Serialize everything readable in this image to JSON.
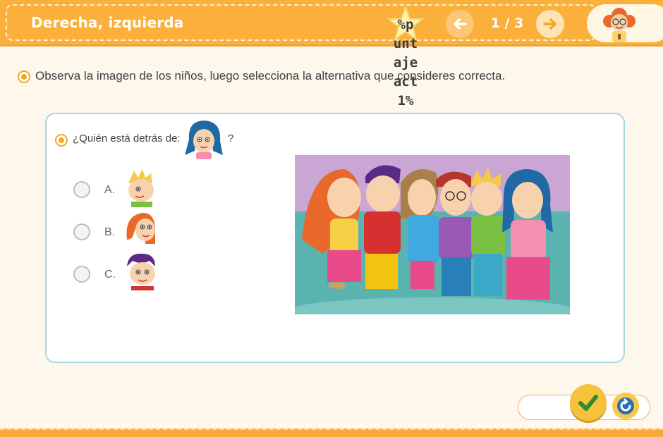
{
  "header": {
    "title": "Derecha, izquierda",
    "score_text": "%p\nunt\naje\nact\n1%",
    "page_indicator": "1 / 3"
  },
  "instruction": "Observa la imagen de los niños, luego selecciona la alternativa que consideres correcta.",
  "question": {
    "text": "¿Quién está detrás de:",
    "suffix": "?"
  },
  "options": [
    {
      "label": "A."
    },
    {
      "label": "B."
    },
    {
      "label": "C."
    }
  ],
  "colors": {
    "header": "#fbb03b",
    "accent": "#f5a623",
    "card_border": "#a8d6e3",
    "check_button": "#f7c23b",
    "check_mark": "#2e8b2e"
  },
  "icons": {
    "prev": "arrow-left-icon",
    "next": "arrow-right-icon",
    "check": "check-icon",
    "reset": "refresh-icon"
  }
}
